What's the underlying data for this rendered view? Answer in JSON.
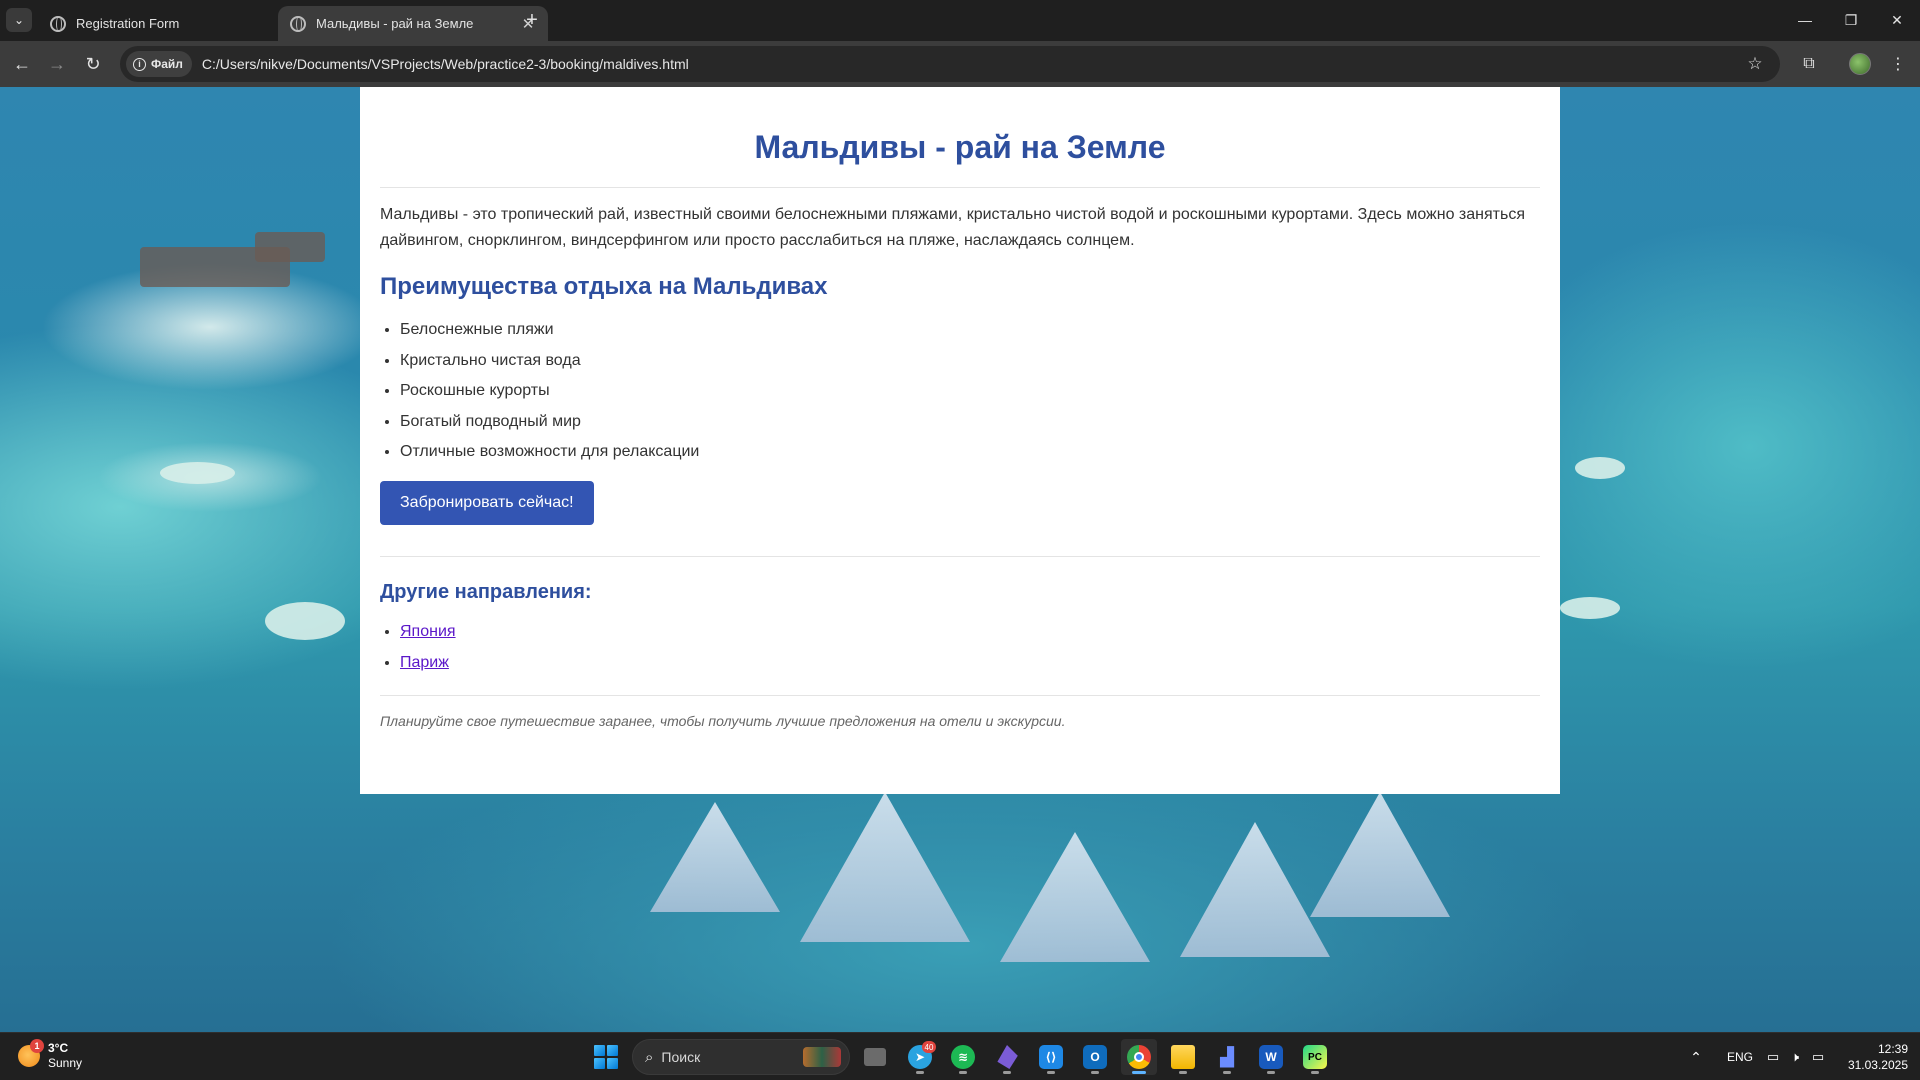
{
  "browser": {
    "tabs": [
      {
        "title": "Registration Form",
        "close": "✕"
      },
      {
        "title": "Мальдивы - рай на Земле",
        "close": "✕"
      }
    ],
    "new_tab": "+",
    "tab_search": "⌄",
    "window_controls": {
      "minimize": "—",
      "restore": "❐",
      "close": "✕"
    },
    "site_info_chip": "Файл",
    "url": "C:/Users/nikve/Documents/VSProjects/Web/practice2-3/booking/maldives.html",
    "nav": {
      "back": "←",
      "forward": "→",
      "reload": "↻"
    },
    "bookmark_star": "☆",
    "extensions_icon": "⧉",
    "menu_icon": "⋮"
  },
  "page": {
    "title": "Мальдивы - рай на Земле",
    "intro": "Мальдивы - это тропический рай, известный своими белоснежными пляжами, кристально чистой водой и роскошными курортами. Здесь можно заняться дайвингом, снорклингом, виндсерфингом или просто расслабиться на пляже, наслаждаясь солнцем.",
    "benefits_heading": "Преимущества отдыха на Мальдивах",
    "benefits": [
      "Белоснежные пляжи",
      "Кристально чистая вода",
      "Роскошные курорты",
      "Богатый подводный мир",
      "Отличные возможности для релаксации"
    ],
    "book_button": "Забронировать сейчас!",
    "other_heading": "Другие направления:",
    "other_links": [
      "Япония",
      "Париж"
    ],
    "note": "Планируйте свое путешествие заранее, чтобы получить лучшие предложения на отели и экскурсии."
  },
  "taskbar": {
    "weather": {
      "temp": "3°C",
      "condition": "Sunny",
      "badge": "1"
    },
    "search_placeholder": "Поиск",
    "telegram_badge": "40",
    "language": "ENG",
    "time": "12:39",
    "date": "31.03.2025"
  },
  "colors": {
    "heading": "#2e4f9e",
    "button": "#3355b3",
    "link": "#5b17c9",
    "browser_chrome": "#3c3c3c",
    "taskbar": "#202020"
  }
}
